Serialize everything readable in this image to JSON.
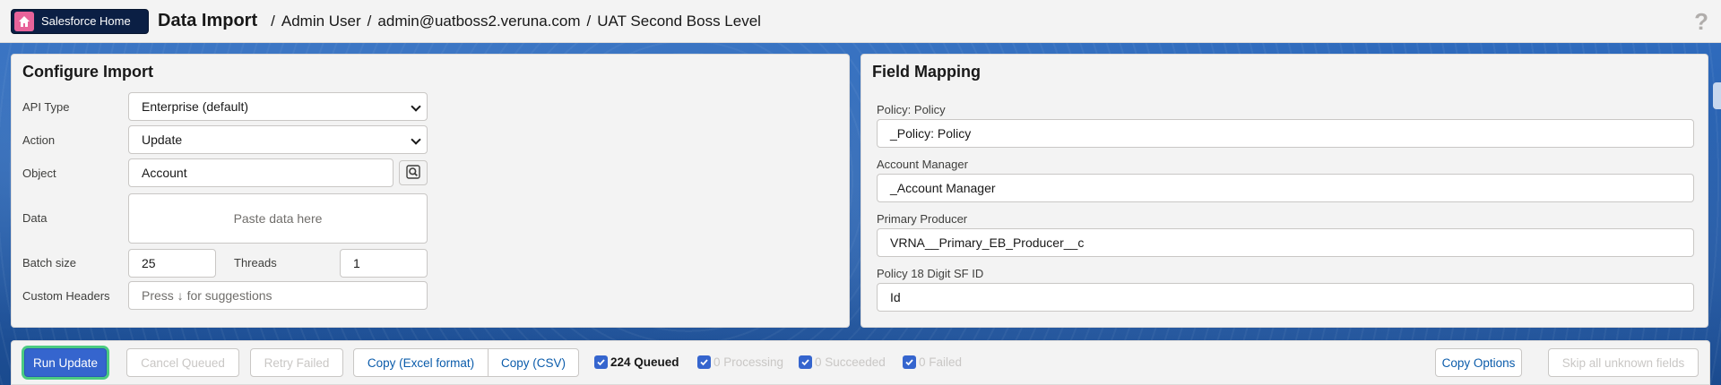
{
  "header": {
    "home_label": "Salesforce Home",
    "title": "Data Import",
    "user": "Admin User",
    "username": "admin@uatboss2.veruna.com",
    "org": "UAT Second Boss Level",
    "help": "?"
  },
  "configure": {
    "title": "Configure Import",
    "api_type_label": "API Type",
    "api_type_value": "Enterprise (default)",
    "action_label": "Action",
    "action_value": "Update",
    "object_label": "Object",
    "object_value": "Account",
    "data_label": "Data",
    "data_placeholder": "Paste data here",
    "batch_label": "Batch size",
    "batch_value": "25",
    "threads_label": "Threads",
    "threads_value": "1",
    "custom_headers_label": "Custom Headers",
    "custom_headers_placeholder": "Press ↓ for suggestions"
  },
  "mapping": {
    "title": "Field Mapping",
    "fields": [
      {
        "label": "Policy: Policy",
        "value": "_Policy: Policy"
      },
      {
        "label": "Account Manager",
        "value": "_Account Manager"
      },
      {
        "label": "Primary Producer",
        "value": "VRNA__Primary_EB_Producer__c"
      },
      {
        "label": "Policy 18 Digit SF ID",
        "value": "Id"
      }
    ]
  },
  "footer": {
    "run": "Run Update",
    "cancel": "Cancel Queued",
    "retry": "Retry Failed",
    "copy_excel": "Copy (Excel format)",
    "copy_csv": "Copy (CSV)",
    "queued": "224 Queued",
    "processing": "0 Processing",
    "succeeded": "0 Succeeded",
    "failed": "0 Failed",
    "copy_options": "Copy Options",
    "skip": "Skip all unknown fields"
  },
  "colors": {
    "brand_dark": "#0b1f44",
    "primary": "#3565ce",
    "focus_ring": "#4bca81",
    "link": "#0b5cab"
  }
}
